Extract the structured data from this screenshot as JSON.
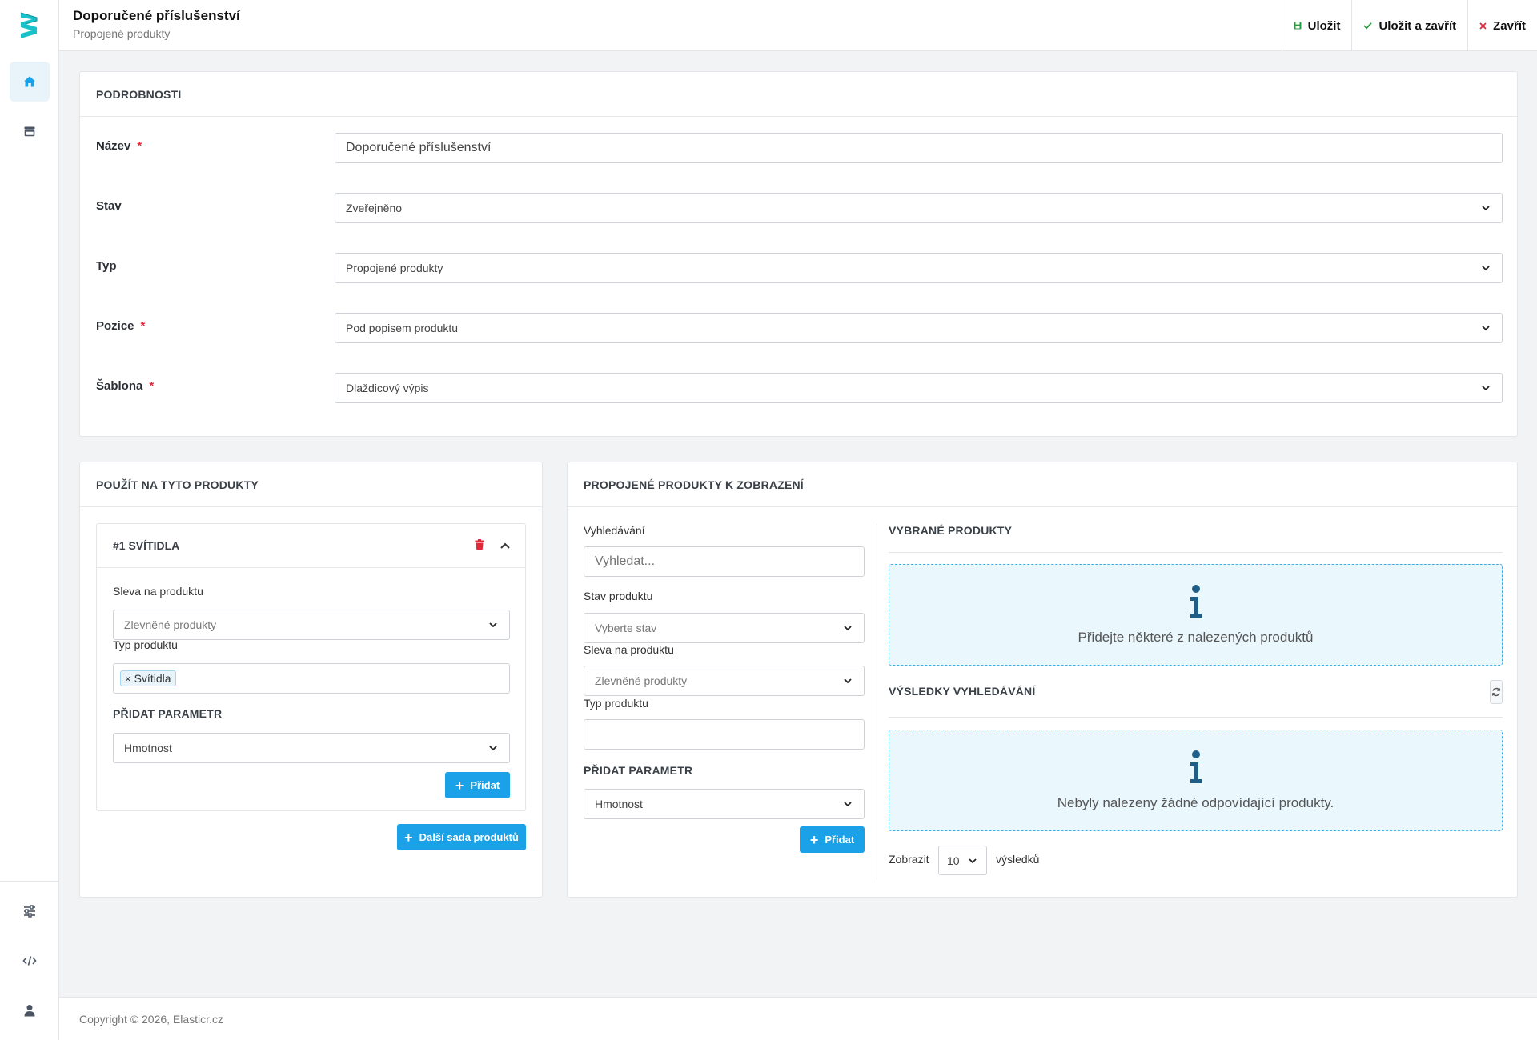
{
  "colors": {
    "accent": "#1aa1e8",
    "brand": "#17c3c8",
    "required": "#e2293a",
    "danger": "#e2293a",
    "success": "#2a9a3e"
  },
  "header": {
    "title": "Doporučené příslušenství",
    "subtitle": "Propojené produkty",
    "actions": [
      {
        "label": "Uložit",
        "icon": "save-icon"
      },
      {
        "label": "Uložit a zavřít",
        "icon": "check-icon"
      },
      {
        "label": "Zavřít",
        "icon": "close-icon"
      }
    ]
  },
  "sidebar": {
    "top": [
      {
        "icon": "home-icon",
        "active": true
      },
      {
        "icon": "store-icon",
        "active": false
      }
    ],
    "bottom": [
      {
        "icon": "sliders-icon"
      },
      {
        "icon": "code-icon"
      },
      {
        "icon": "user-icon"
      }
    ]
  },
  "details": {
    "heading": "PODROBNOSTI",
    "fields": [
      {
        "label": "Název",
        "required": true,
        "value": "Doporučené příslušenství",
        "type": "text"
      },
      {
        "label": "Stav",
        "required": false,
        "value": "Zveřejněno",
        "type": "select"
      },
      {
        "label": "Typ",
        "required": false,
        "value": "Propojené produkty",
        "type": "select"
      },
      {
        "label": "Pozice",
        "required": true,
        "value": "Pod popisem produktu",
        "type": "select"
      },
      {
        "label": "Šablona",
        "required": true,
        "value": "Dlaždicový výpis",
        "type": "select"
      }
    ],
    "required_mark": "*"
  },
  "apply": {
    "heading": "POUŽÍT NA TYTO PRODUKTY",
    "set": {
      "title": "#1 SVÍTIDLA",
      "discount_label": "Sleva na produktu",
      "discount_value": "Zlevněné produkty",
      "type_label": "Typ produktu",
      "type_tag": "Svítidla",
      "tag_remove": "×",
      "param_label": "PŘIDAT PARAMETR",
      "param_value": "Hmotnost",
      "add_label": "Přidat"
    },
    "next_set_label": "Další sada produktů"
  },
  "linked": {
    "heading": "PROPOJENÉ PRODUKTY K ZOBRAZENÍ",
    "search_label": "Vyhledávání",
    "search_placeholder": "Vyhledat...",
    "status_label": "Stav produktu",
    "status_placeholder": "Vyberte stav",
    "discount_label": "Sleva na produktu",
    "discount_value": "Zlevněné produkty",
    "type_label": "Typ produktu",
    "type_value": "",
    "param_label": "PŘIDAT PARAMETR",
    "param_value": "Hmotnost",
    "add_label": "Přidat",
    "selected_heading": "VYBRANÉ PRODUKTY",
    "selected_empty": "Přidejte některé z nalezených produktů",
    "results_heading": "VÝSLEDKY VYHLEDÁVÁNÍ",
    "results_empty": "Nebyly nalezeny žádné odpovídající produkty.",
    "show_label": "Zobrazit",
    "page_size": "10",
    "results_suffix": "výsledků"
  },
  "footer": {
    "copyright": "Copyright © 2026, Elasticr.cz"
  }
}
